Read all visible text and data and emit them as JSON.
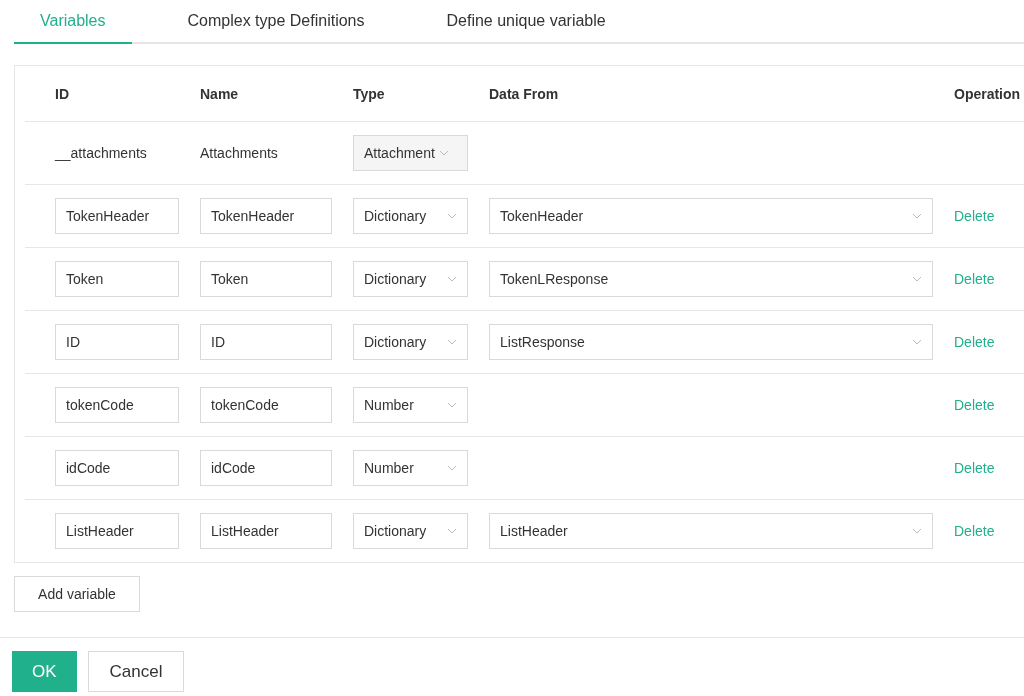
{
  "tabs": [
    {
      "label": "Variables",
      "selected": true
    },
    {
      "label": "Complex type Definitions",
      "selected": false
    },
    {
      "label": "Define unique variable",
      "selected": false
    }
  ],
  "table": {
    "columns": [
      "ID",
      "Name",
      "Type",
      "Data From",
      "Operation"
    ],
    "rows": [
      {
        "kind": "fixed",
        "id": "__attachments",
        "name": "Attachments",
        "type": "Attachment",
        "type_disabled": true
      },
      {
        "kind": "editable",
        "id": "TokenHeader",
        "name": "TokenHeader",
        "type": "Dictionary",
        "type_disabled": false,
        "data_from": "TokenHeader",
        "operation": "Delete"
      },
      {
        "kind": "editable",
        "id": "Token",
        "name": "Token",
        "type": "Dictionary",
        "type_disabled": false,
        "data_from": "TokenLResponse",
        "operation": "Delete"
      },
      {
        "kind": "editable",
        "id": "ID",
        "name": "ID",
        "type": "Dictionary",
        "type_disabled": false,
        "data_from": "ListResponse",
        "operation": "Delete"
      },
      {
        "kind": "editable",
        "id": "tokenCode",
        "name": "tokenCode",
        "type": "Number",
        "type_disabled": false,
        "operation": "Delete"
      },
      {
        "kind": "editable",
        "id": "idCode",
        "name": "idCode",
        "type": "Number",
        "type_disabled": false,
        "operation": "Delete"
      },
      {
        "kind": "editable",
        "id": "ListHeader",
        "name": "ListHeader",
        "type": "Dictionary",
        "type_disabled": false,
        "data_from": "ListHeader",
        "operation": "Delete"
      }
    ]
  },
  "add_button": "Add variable",
  "buttons": [
    {
      "label": "OK",
      "kind": "primary"
    },
    {
      "label": "Cancel",
      "kind": "default"
    }
  ]
}
